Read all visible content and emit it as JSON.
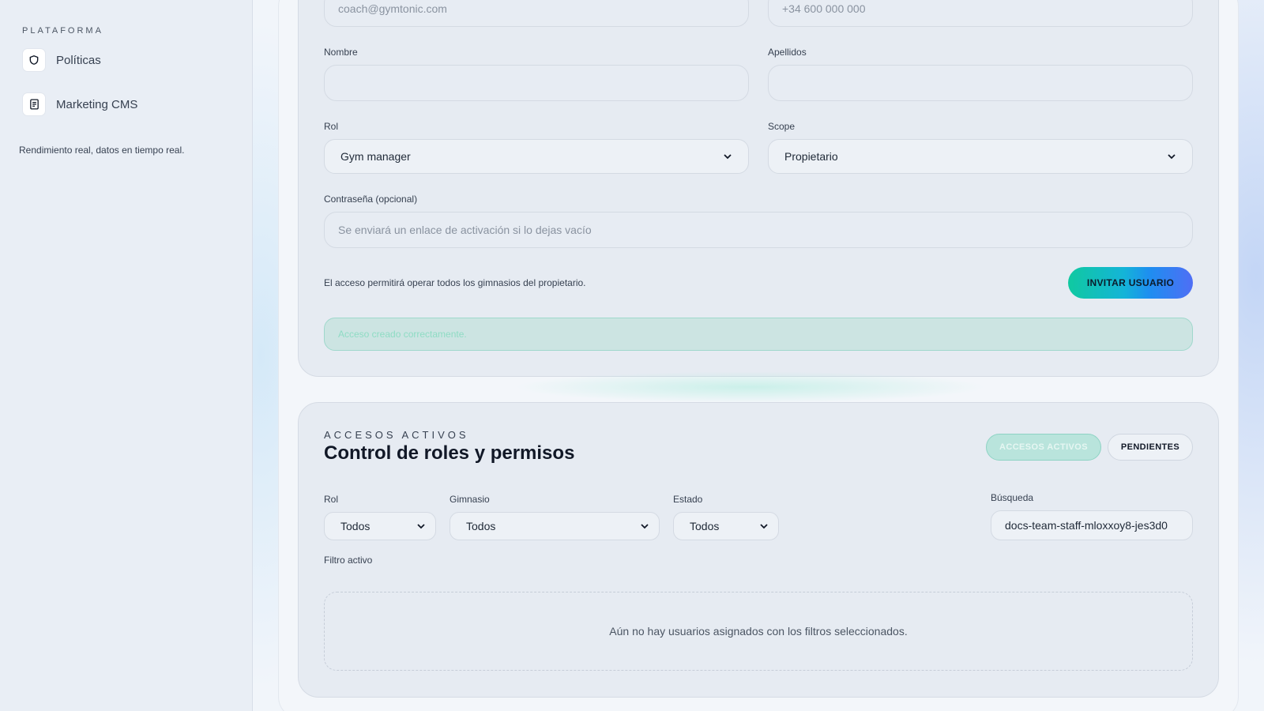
{
  "sidebar": {
    "section_label": "PLATAFORMA",
    "items": [
      {
        "label": "Políticas",
        "icon": "shield-icon"
      },
      {
        "label": "Marketing CMS",
        "icon": "document-icon"
      }
    ],
    "footer_text": "Rendimiento real, datos en tiempo real."
  },
  "invite_form": {
    "email_placeholder": "coach@gymtonic.com",
    "phone_placeholder": "+34 600 000 000",
    "nombre_label": "Nombre",
    "nombre_value": "",
    "apellidos_label": "Apellidos",
    "apellidos_value": "",
    "rol_label": "Rol",
    "rol_value": "Gym manager",
    "scope_label": "Scope",
    "scope_value": "Propietario",
    "password_label": "Contraseña (opcional)",
    "password_placeholder": "Se enviará un enlace de activación si lo dejas vacío",
    "hint": "El acceso permitirá operar todos los gimnasios del propietario.",
    "invite_button": "INVITAR USUARIO",
    "success_message": "Acceso creado correctamente."
  },
  "access_list": {
    "eyebrow": "ACCESOS ACTIVOS",
    "title": "Control de roles y permisos",
    "tab_active": "ACCESOS ACTIVOS",
    "tab_pending": "PENDIENTES",
    "filters": {
      "rol_label": "Rol",
      "rol_value": "Todos",
      "gimnasio_label": "Gimnasio",
      "gimnasio_value": "Todos",
      "estado_label": "Estado",
      "estado_value": "Todos",
      "busqueda_label": "Búsqueda",
      "busqueda_value": "docs-team-staff-mloxxoy8-jes3d0"
    },
    "active_filter_label": "Filtro activo",
    "empty_message": "Aún no hay usuarios asignados con los filtros seleccionados."
  },
  "colors": {
    "accent_teal": "#10c9a0",
    "accent_blue": "#1e8ef0",
    "accent_indigo": "#4f6ef5"
  }
}
